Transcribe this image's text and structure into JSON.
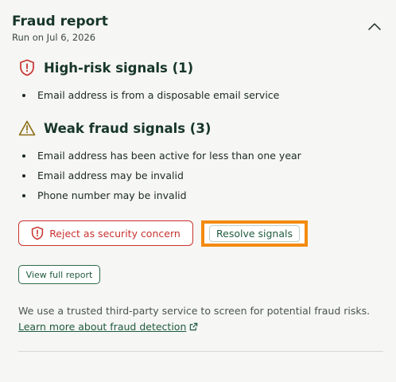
{
  "report": {
    "title": "Fraud report",
    "run_date": "Run on Jul 6, 2026"
  },
  "high_risk": {
    "heading": "High-risk signals (1)",
    "icon": "shield-alert-icon",
    "color": "#c8322f",
    "items": [
      "Email address is from a disposable email service"
    ]
  },
  "weak": {
    "heading": "Weak fraud signals (3)",
    "icon": "warning-triangle-icon",
    "color": "#8a6b12",
    "items": [
      "Email address has been active for less than one year",
      "Email address may be invalid",
      "Phone number may be invalid"
    ]
  },
  "actions": {
    "reject_label": "Reject as security concern",
    "resolve_label": "Resolve signals",
    "view_full_label": "View full report"
  },
  "info": {
    "text": "We use a trusted third-party service to screen for potential fraud risks.",
    "link_label": "Learn more about fraud detection"
  },
  "colors": {
    "accent": "#1f5b3e",
    "danger": "#c8322f",
    "highlight": "#f48a10",
    "background": "#f6f6f4"
  }
}
